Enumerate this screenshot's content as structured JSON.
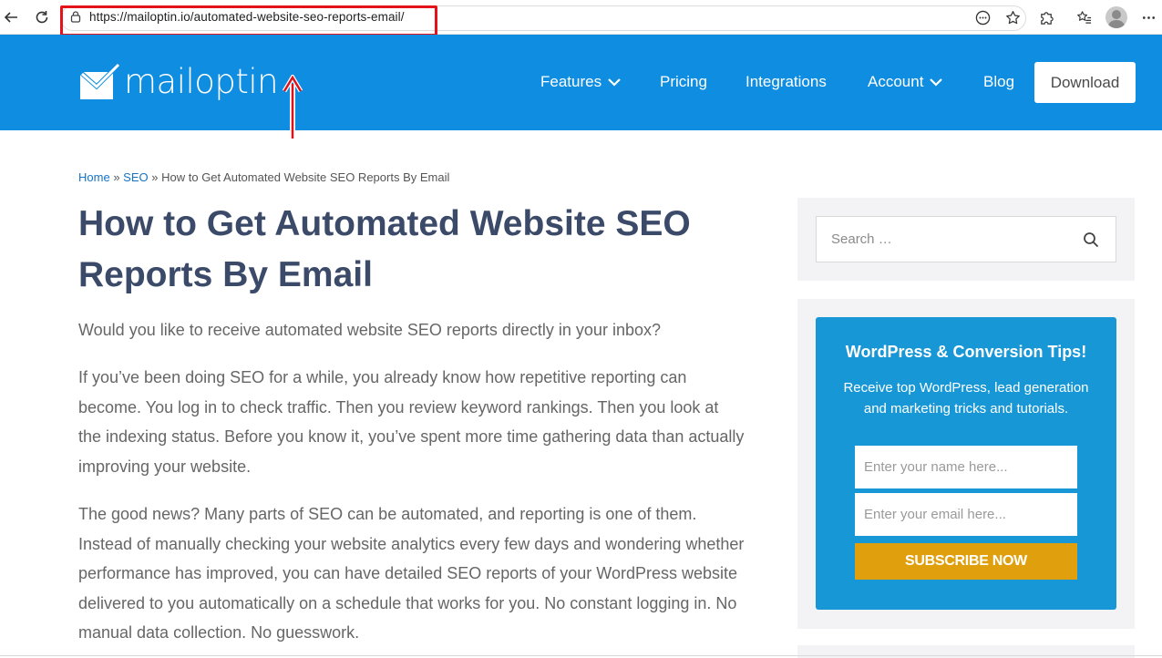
{
  "browser": {
    "url": "https://mailoptin.io/automated-website-seo-reports-email/"
  },
  "header": {
    "logo_text": "mailoptin",
    "nav": [
      {
        "label": "Features",
        "dropdown": true
      },
      {
        "label": "Pricing",
        "dropdown": false
      },
      {
        "label": "Integrations",
        "dropdown": false
      },
      {
        "label": "Account",
        "dropdown": true
      },
      {
        "label": "Blog",
        "dropdown": false
      }
    ],
    "download_label": "Download",
    "brand_color": "#0f8de0"
  },
  "breadcrumb": {
    "home": "Home",
    "separator": "»",
    "category": "SEO",
    "current": "How to Get Automated Website SEO Reports By Email"
  },
  "article": {
    "title_line1": "How to Get Automated Website SEO",
    "title_line2": "Reports By Email",
    "paragraphs": [
      [
        "Would you like to receive automated website SEO reports directly in your inbox?"
      ],
      [
        "If you’ve been doing SEO for a while, you already know how repetitive reporting can",
        "become. You log in to check traffic. Then you review keyword rankings. Then you look at",
        "the indexing status. Before you know it, you’ve spent more time gathering data than actually",
        "improving your website."
      ],
      [
        "The good news? Many parts of SEO can be automated, and reporting is one of them.",
        "Instead of manually checking your website analytics every few days and wondering whether",
        "performance has improved, you can have detailed SEO reports of your WordPress website",
        "delivered to you automatically on a schedule that works for you. No constant logging in. No",
        "manual data collection. No guesswork."
      ]
    ]
  },
  "sidebar": {
    "search_placeholder": "Search …",
    "optin": {
      "title": "WordPress & Conversion Tips!",
      "desc_line1": "Receive top WordPress, lead generation",
      "desc_line2": "and marketing tricks and tutorials.",
      "name_placeholder": "Enter your name here...",
      "email_placeholder": "Enter your email here...",
      "button_label": "SUBSCRIBE NOW",
      "box_color": "#1897d6",
      "button_color": "#e0a00e"
    }
  }
}
